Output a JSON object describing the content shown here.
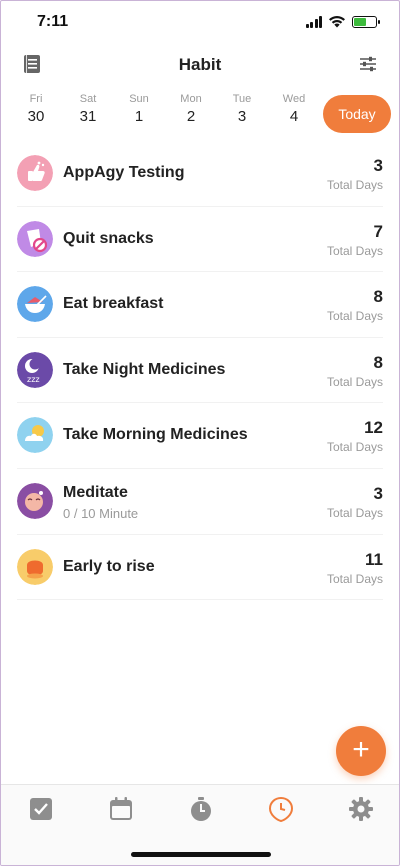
{
  "status": {
    "time": "7:11"
  },
  "header": {
    "title": "Habit"
  },
  "dates": [
    {
      "weekday": "Fri",
      "day": "30"
    },
    {
      "weekday": "Sat",
      "day": "31"
    },
    {
      "weekday": "Sun",
      "day": "1"
    },
    {
      "weekday": "Mon",
      "day": "2"
    },
    {
      "weekday": "Tue",
      "day": "3"
    },
    {
      "weekday": "Wed",
      "day": "4"
    }
  ],
  "today_label": "Today",
  "habits": [
    {
      "name": "AppAgy Testing",
      "count": "3",
      "unit": "Total Days",
      "icon": "thumbs-up-icon"
    },
    {
      "name": "Quit snacks",
      "count": "7",
      "unit": "Total Days",
      "icon": "no-snacks-icon"
    },
    {
      "name": "Eat breakfast",
      "count": "8",
      "unit": "Total Days",
      "icon": "breakfast-bowl-icon"
    },
    {
      "name": "Take Night Medicines",
      "count": "8",
      "unit": "Total Days",
      "icon": "moon-sleep-icon"
    },
    {
      "name": "Take Morning Medicines",
      "count": "12",
      "unit": "Total Days",
      "icon": "sun-cloud-icon"
    },
    {
      "name": "Meditate",
      "sub": "0 / 10 Minute",
      "count": "3",
      "unit": "Total Days",
      "icon": "meditate-face-icon"
    },
    {
      "name": "Early to rise",
      "count": "11",
      "unit": "Total Days",
      "icon": "sunrise-icon"
    }
  ],
  "fab": {
    "label": "+"
  },
  "tabs": [
    "checklist-icon",
    "calendar-icon",
    "timer-icon",
    "habit-clock-icon",
    "settings-gear-icon"
  ],
  "colors": {
    "accent": "#f07d3c",
    "text": "#222222",
    "muted": "#9a9a9a"
  }
}
